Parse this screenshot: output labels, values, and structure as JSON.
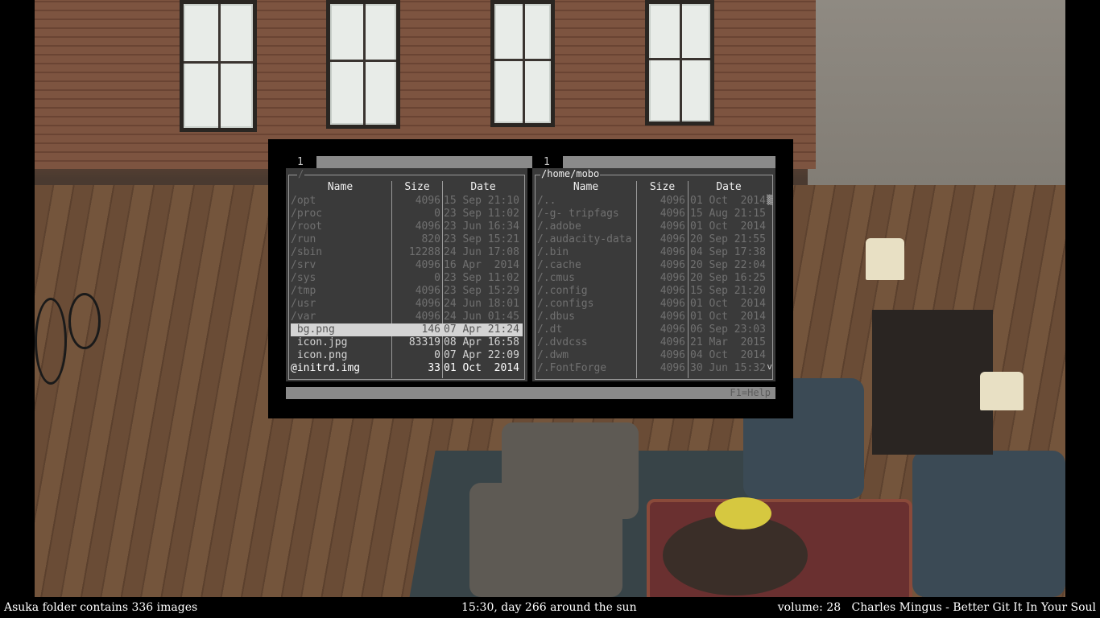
{
  "file_manager": {
    "left_tab": "1",
    "right_tab": "1",
    "help_hint": "F1=Help",
    "left_panel": {
      "path": "/",
      "columns": {
        "name": "Name",
        "size": "Size",
        "date": "Date"
      },
      "rows": [
        {
          "name": "/opt",
          "size": "4096",
          "date": "15 Sep 21:10",
          "kind": "dir"
        },
        {
          "name": "/proc",
          "size": "0",
          "date": "23 Sep 11:02",
          "kind": "dir"
        },
        {
          "name": "/root",
          "size": "4096",
          "date": "23 Jun 16:34",
          "kind": "dir"
        },
        {
          "name": "/run",
          "size": "820",
          "date": "23 Sep 15:21",
          "kind": "dir"
        },
        {
          "name": "/sbin",
          "size": "12288",
          "date": "24 Jun 17:08",
          "kind": "dir"
        },
        {
          "name": "/srv",
          "size": "4096",
          "date": "16 Apr  2014",
          "kind": "dir"
        },
        {
          "name": "/sys",
          "size": "0",
          "date": "23 Sep 11:02",
          "kind": "dir"
        },
        {
          "name": "/tmp",
          "size": "4096",
          "date": "23 Sep 15:29",
          "kind": "dir"
        },
        {
          "name": "/usr",
          "size": "4096",
          "date": "24 Jun 18:01",
          "kind": "dir"
        },
        {
          "name": "/var",
          "size": "4096",
          "date": "24 Jun 01:45",
          "kind": "dir"
        },
        {
          "name": " bg.png",
          "size": "146",
          "date": "07 Apr 21:24",
          "kind": "cur"
        },
        {
          "name": " icon.jpg",
          "size": "83319",
          "date": "08 Apr 16:58",
          "kind": "file"
        },
        {
          "name": " icon.png",
          "size": "0",
          "date": "07 Apr 22:09",
          "kind": "file"
        },
        {
          "name": "@initrd.img",
          "size": "33",
          "date": "01 Oct  2014",
          "kind": "exe"
        }
      ]
    },
    "right_panel": {
      "path": "/home/mobo",
      "columns": {
        "name": "Name",
        "size": "Size",
        "date": "Date"
      },
      "rows": [
        {
          "name": "/..",
          "size": "4096",
          "date": "01 Oct  2014",
          "kind": "dir"
        },
        {
          "name": "/-g- tripfags",
          "size": "4096",
          "date": "15 Aug 21:15",
          "kind": "dir"
        },
        {
          "name": "/.adobe",
          "size": "4096",
          "date": "01 Oct  2014",
          "kind": "dir"
        },
        {
          "name": "/.audacity-data",
          "size": "4096",
          "date": "20 Sep 21:55",
          "kind": "dir"
        },
        {
          "name": "/.bin",
          "size": "4096",
          "date": "04 Sep 17:38",
          "kind": "dir"
        },
        {
          "name": "/.cache",
          "size": "4096",
          "date": "20 Sep 22:04",
          "kind": "dir"
        },
        {
          "name": "/.cmus",
          "size": "4096",
          "date": "20 Sep 16:25",
          "kind": "dir"
        },
        {
          "name": "/.config",
          "size": "4096",
          "date": "15 Sep 21:20",
          "kind": "dir"
        },
        {
          "name": "/.configs",
          "size": "4096",
          "date": "01 Oct  2014",
          "kind": "dir"
        },
        {
          "name": "/.dbus",
          "size": "4096",
          "date": "01 Oct  2014",
          "kind": "dir"
        },
        {
          "name": "/.dt",
          "size": "4096",
          "date": "06 Sep 23:03",
          "kind": "dir"
        },
        {
          "name": "/.dvdcss",
          "size": "4096",
          "date": "21 Mar  2015",
          "kind": "dir"
        },
        {
          "name": "/.dwm",
          "size": "4096",
          "date": "04 Oct  2014",
          "kind": "dir"
        },
        {
          "name": "/.FontForge",
          "size": "4096",
          "date": "30 Jun 15:32",
          "kind": "dir"
        }
      ]
    }
  },
  "status_bar": {
    "left": "Asuka folder contains 336 images",
    "center": "15:30, day 266 around the sun",
    "right": "volume: 28   Charles Mingus - Better Git It In Your Soul"
  }
}
